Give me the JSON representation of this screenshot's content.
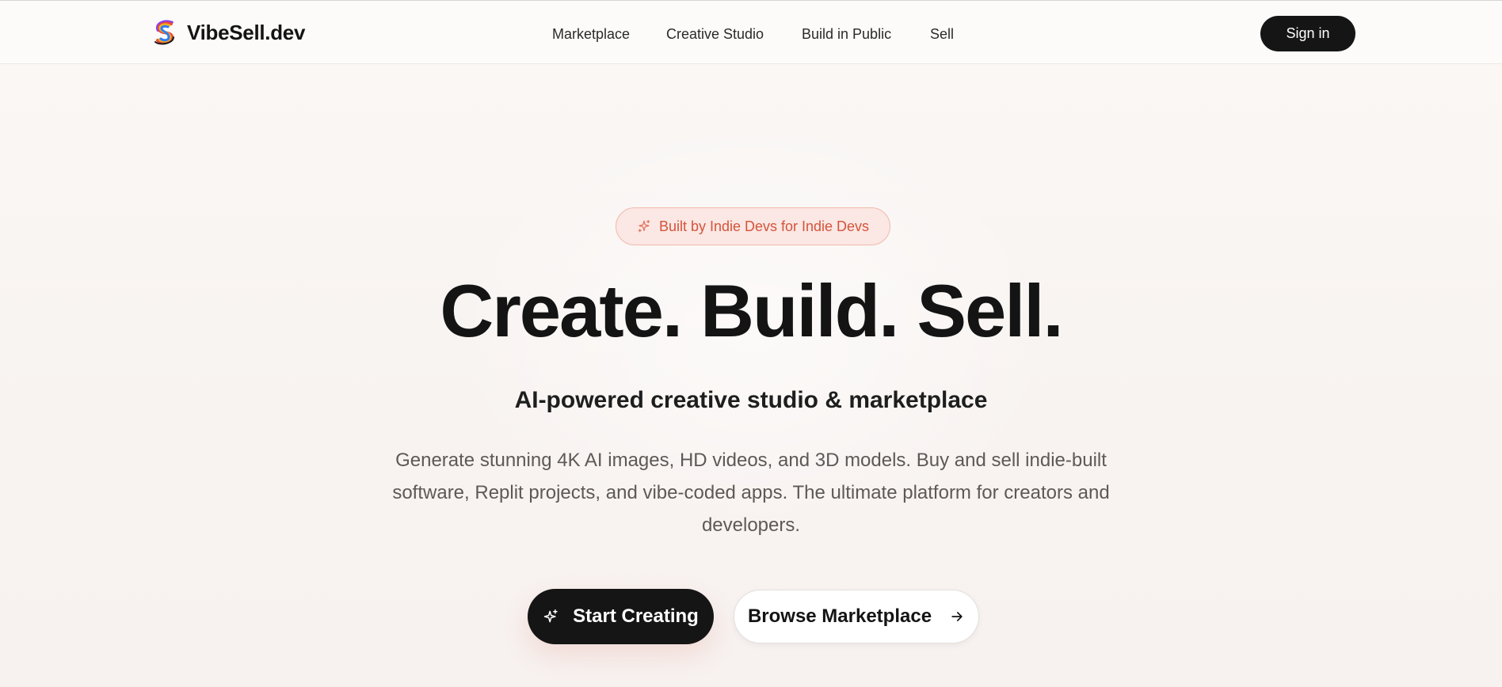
{
  "brand": {
    "name": "VibeSell.dev"
  },
  "nav": {
    "items": [
      {
        "label": "Marketplace"
      },
      {
        "label": "Creative Studio"
      },
      {
        "label": "Build in Public"
      },
      {
        "label": "Sell"
      }
    ],
    "signin_label": "Sign in"
  },
  "hero": {
    "badge": "Built by Indie Devs for Indie Devs",
    "headline": "Create. Build. Sell.",
    "subtitle": "AI-powered creative studio & marketplace",
    "description": "Generate stunning 4K AI images, HD videos, and 3D models. Buy and sell indie-built software, Replit projects, and vibe-coded apps. The ultimate platform for creators and developers.",
    "primary_cta": "Start Creating",
    "secondary_cta": "Browse Marketplace"
  },
  "icons": {
    "logo": "vibesell-logo-icon",
    "badge": "sparkles-icon",
    "primary_cta": "sparkles-icon",
    "secondary_cta": "arrow-right-icon"
  },
  "colors": {
    "accent": "#d4543c",
    "badge_bg": "#fbe7e3",
    "dark": "#151515",
    "background": "#faf8f6"
  }
}
